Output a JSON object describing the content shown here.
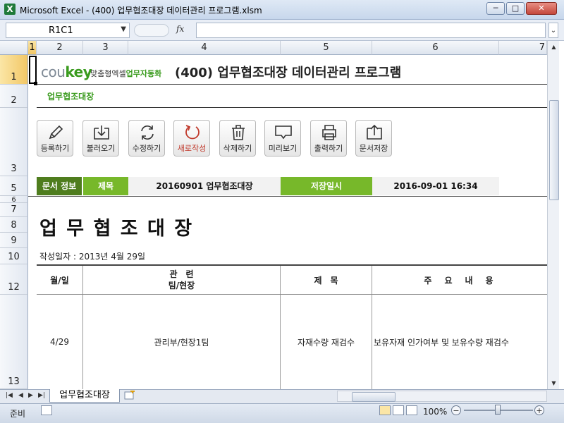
{
  "window": {
    "title": "Microsoft Excel - (400) 업무협조대장 데이터관리 프로그램.xlsm",
    "app_icon": "X",
    "minimize": "─",
    "maximize": "□",
    "close": "✕"
  },
  "formula_bar": {
    "name_box": "R1C1",
    "fx_label": "fx",
    "formula": ""
  },
  "columns": [
    "1",
    "2",
    "3",
    "4",
    "5",
    "6",
    "7"
  ],
  "rows": [
    "1",
    "2",
    "3",
    "5",
    "6",
    "7",
    "8",
    "9",
    "10",
    "12",
    "13"
  ],
  "header": {
    "logo_co": "cou",
    "logo_key": "key",
    "logo_sub_a": "맞춤형엑셀",
    "logo_sub_b": "업무자동화",
    "title": "(400) 업무협조대장 데이터관리 프로그램",
    "subtitle": "업무협조대장"
  },
  "toolbar": {
    "buttons": [
      {
        "label": "등록하기",
        "icon": "pencil-icon"
      },
      {
        "label": "불러오기",
        "icon": "import-icon"
      },
      {
        "label": "수정하기",
        "icon": "refresh-icon"
      },
      {
        "label": "새로작성",
        "icon": "new-doc-icon"
      },
      {
        "label": "삭제하기",
        "icon": "trash-icon"
      },
      {
        "label": "미리보기",
        "icon": "monitor-icon"
      },
      {
        "label": "출력하기",
        "icon": "printer-icon"
      },
      {
        "label": "문서저장",
        "icon": "export-icon"
      }
    ]
  },
  "doc_info": {
    "label": "문서 정보",
    "title_label": "제목",
    "title_value": "20160901 업무협조대장",
    "saved_label": "저장일시",
    "saved_value": "2016-09-01 16:34"
  },
  "document": {
    "heading": "업 무 협 조 대 장",
    "date_line": "작성일자 : 2013년 4월 29일",
    "table_headers": {
      "date": "월/일",
      "team_line1": "관　련",
      "team_line2": "팀/현장",
      "subject": "제　목",
      "content": "주　요　내　용"
    },
    "rows": [
      {
        "date": "4/29",
        "team": "관리부/현장1팀",
        "subject": "자재수량 재검수",
        "content": "보유자재 인가여부 및 보유수량 재검수"
      }
    ]
  },
  "sheet_tabs": {
    "active": "업무협조대장"
  },
  "status": {
    "ready": "준비",
    "zoom": "100%",
    "zoom_value": 100
  },
  "colors": {
    "green": "#77b82a",
    "dark_green": "#4f7d1e",
    "logo_green": "#3a9b1e",
    "selection_header": "#f2c766"
  }
}
